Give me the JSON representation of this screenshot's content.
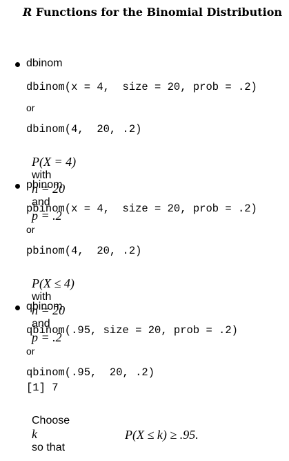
{
  "title": "Functions for the Binomial Distribution",
  "title_prefix": "R",
  "sections": [
    {
      "name": "dbinom",
      "call_named": "dbinom(x = 4,  size = 20, prob = .2)",
      "or": "or",
      "call_positional": "dbinom(4,  20, .2)",
      "desc_math": "P(X = 4)",
      "desc_with": "with",
      "desc_n": "n = 20",
      "desc_and": "and",
      "desc_p": "p = .2"
    },
    {
      "name": "pbinom",
      "call_named": "pbinom(x = 4,  size = 20, prob = .2)",
      "or": "or",
      "call_positional": "pbinom(4,  20, .2)",
      "desc_math": "P(X ≤ 4)",
      "desc_with": "with",
      "desc_n": "n = 20",
      "desc_and": "and",
      "desc_p": "p = .2"
    },
    {
      "name": "qbinom",
      "call_named": "qbinom(.95, size = 20, prob = .2)",
      "or": "or",
      "call_positional": "qbinom(.95,  20, .2)",
      "output": "[1] 7",
      "choose_prefix": "Choose",
      "choose_var": "k",
      "choose_suffix": "so that",
      "final_math": "P(X ≤ k) ≥ .95."
    }
  ]
}
